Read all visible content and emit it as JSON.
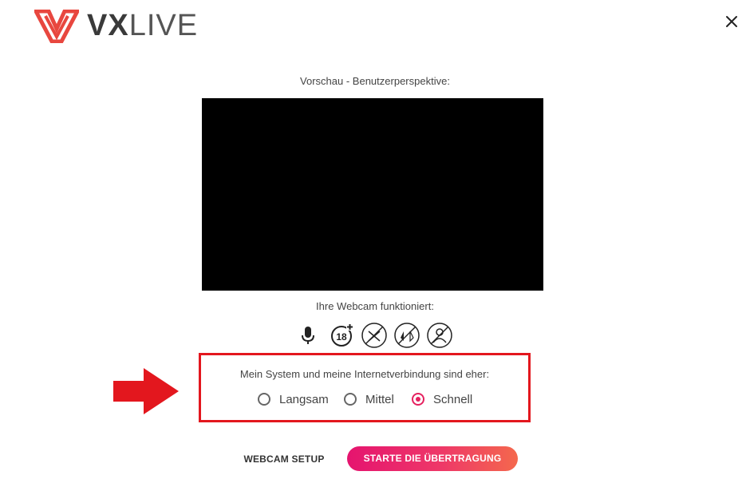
{
  "header": {
    "logo_bold": "VX",
    "logo_thin": "LIVE"
  },
  "preview": {
    "label": "Vorschau - Benutzerperspektive:"
  },
  "webcam": {
    "status_label": "Ihre Webcam funktioniert:",
    "icons": [
      "microphone-icon",
      "age-18-plus-icon",
      "disabled-crossed-icon",
      "disabled-flip-icon",
      "disabled-user-icon"
    ]
  },
  "speed": {
    "label": "Mein System und meine Internetverbindung sind eher:",
    "options": [
      {
        "label": "Langsam",
        "checked": false
      },
      {
        "label": "Mittel",
        "checked": false
      },
      {
        "label": "Schnell",
        "checked": true
      }
    ]
  },
  "actions": {
    "setup_label": "WEBCAM SETUP",
    "start_label": "STARTE DIE ÜBERTRAGUNG"
  },
  "colors": {
    "accent": "#e5215f",
    "highlight_border": "#e3171e",
    "logo_red": "#e8473f"
  }
}
